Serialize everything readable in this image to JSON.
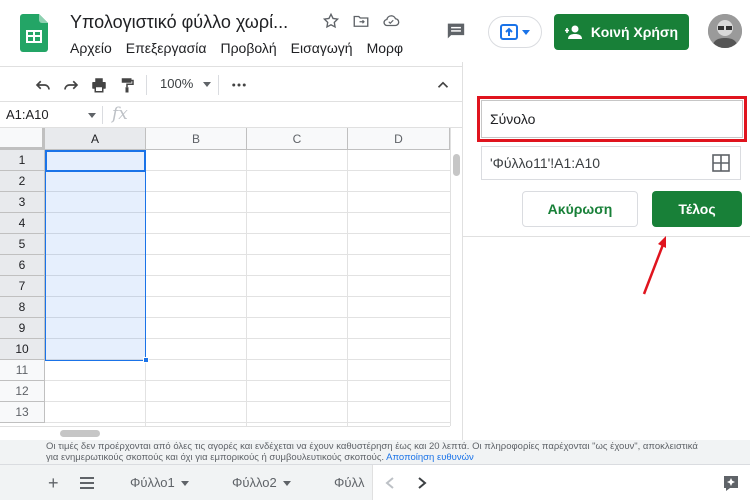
{
  "document": {
    "title": "Υπολογιστικό φύλλο χωρί...",
    "menu": [
      "Αρχείο",
      "Επεξεργασία",
      "Προβολή",
      "Εισαγωγή",
      "Μορφ"
    ]
  },
  "header": {
    "share_label": "Κοινή Χρήση"
  },
  "toolbar": {
    "zoom": "100%"
  },
  "formula_bar": {
    "name_box": "A1:A10",
    "fx": "fx"
  },
  "grid": {
    "columns": [
      "A",
      "B",
      "C",
      "D"
    ],
    "rows": [
      "1",
      "2",
      "3",
      "4",
      "5",
      "6",
      "7",
      "8",
      "9",
      "10",
      "11",
      "12",
      "13"
    ],
    "selected_range": "A1:A10"
  },
  "named_range_panel": {
    "name_value": "Σύνολο",
    "range_value": "'Φύλλο11'!A1:A10",
    "cancel_label": "Ακύρωση",
    "done_label": "Τέλος"
  },
  "disclaimer": {
    "text": "Οι τιμές δεν προέρχονται από όλες τις αγορές και ενδέχεται να έχουν καθυστέρηση έως και 20 λεπτά. Οι πληροφορίες παρέχονται \"ως έχουν\", αποκλειστικά για ενημερωτικούς σκοπούς και όχι για εμπορικούς ή συμβουλευτικούς σκοπούς.",
    "link": "Αποποίηση ευθυνών"
  },
  "sheets": {
    "tabs": [
      "Φύλλο1",
      "Φύλλο2",
      "Φύλλ"
    ]
  },
  "colors": {
    "accent_green": "#188038",
    "selection_blue": "#1a73e8",
    "annotation_red": "#e0141e"
  }
}
